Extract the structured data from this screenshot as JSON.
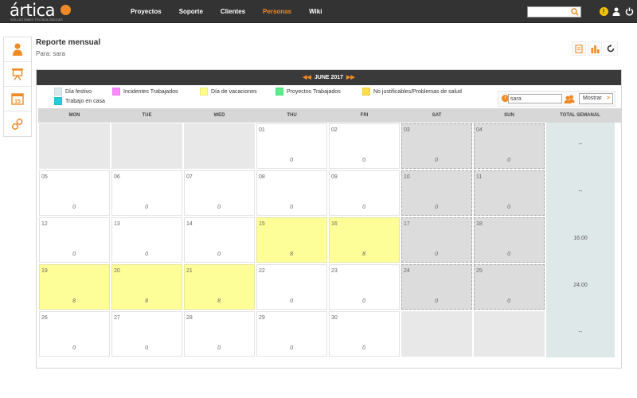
{
  "app": {
    "logo_text": "ártica",
    "logo_subtitle": "SOLUCIONES TECNOLÓGICAS"
  },
  "nav": [
    {
      "label": "Proyectos",
      "active": false
    },
    {
      "label": "Soporte",
      "active": false
    },
    {
      "label": "Clientes",
      "active": false
    },
    {
      "label": "Personas",
      "active": true
    },
    {
      "label": "Wiki",
      "active": false
    }
  ],
  "search": {
    "value": "",
    "placeholder": ""
  },
  "header": {
    "title": "Reporte mensual",
    "subtitle": "Para: sara"
  },
  "calendar": {
    "month_label": "JUNE 2017",
    "legend": [
      {
        "label": "Día festivo",
        "color": "#dbe8ec"
      },
      {
        "label": "Incidentes Trabajados",
        "color": "#ff88ff"
      },
      {
        "label": "Día de vacaciones",
        "color": "#ffff88"
      },
      {
        "label": "Proyectos Trabajados",
        "color": "#55ee88"
      },
      {
        "label": "No justificables/Problemas de salud",
        "color": "#ffdd44"
      },
      {
        "label": "Trabajo en casa",
        "color": "#22ccdd"
      }
    ],
    "filter": {
      "user_value": "sara",
      "button_label": "Mostrar",
      "button_chevron": ">"
    },
    "headers": [
      "MON",
      "TUE",
      "WED",
      "THU",
      "FRI",
      "SAT",
      "SUN",
      "TOTAL SEMANAL"
    ],
    "weeks": [
      {
        "days": [
          {
            "type": "empty"
          },
          {
            "type": "empty"
          },
          {
            "type": "empty"
          },
          {
            "type": "work",
            "day": "01",
            "hours": "0"
          },
          {
            "type": "work",
            "day": "02",
            "hours": "0"
          },
          {
            "type": "weekend",
            "day": "03",
            "hours": "0"
          },
          {
            "type": "weekend",
            "day": "04",
            "hours": "0"
          }
        ],
        "total": "--"
      },
      {
        "days": [
          {
            "type": "work",
            "day": "05",
            "hours": "0"
          },
          {
            "type": "work",
            "day": "06",
            "hours": "0"
          },
          {
            "type": "work",
            "day": "07",
            "hours": "0"
          },
          {
            "type": "work",
            "day": "08",
            "hours": "0"
          },
          {
            "type": "work",
            "day": "09",
            "hours": "0"
          },
          {
            "type": "weekend",
            "day": "10",
            "hours": "0"
          },
          {
            "type": "weekend",
            "day": "11",
            "hours": "0"
          }
        ],
        "total": "--"
      },
      {
        "days": [
          {
            "type": "work",
            "day": "12",
            "hours": "0"
          },
          {
            "type": "work",
            "day": "13",
            "hours": "0"
          },
          {
            "type": "work",
            "day": "14",
            "hours": "0"
          },
          {
            "type": "vac",
            "day": "15",
            "hours": "8"
          },
          {
            "type": "vac",
            "day": "16",
            "hours": "8"
          },
          {
            "type": "weekend",
            "day": "17",
            "hours": "0"
          },
          {
            "type": "weekend",
            "day": "18",
            "hours": "0"
          }
        ],
        "total": "16.00"
      },
      {
        "days": [
          {
            "type": "vac",
            "day": "19",
            "hours": "8"
          },
          {
            "type": "vac",
            "day": "20",
            "hours": "8"
          },
          {
            "type": "vac",
            "day": "21",
            "hours": "8"
          },
          {
            "type": "work",
            "day": "22",
            "hours": "0"
          },
          {
            "type": "work",
            "day": "23",
            "hours": "0"
          },
          {
            "type": "weekend",
            "day": "24",
            "hours": "0"
          },
          {
            "type": "weekend",
            "day": "25",
            "hours": "0"
          }
        ],
        "total": "24.00"
      },
      {
        "days": [
          {
            "type": "work",
            "day": "26",
            "hours": "0"
          },
          {
            "type": "work",
            "day": "27",
            "hours": "0"
          },
          {
            "type": "work",
            "day": "28",
            "hours": "0"
          },
          {
            "type": "work",
            "day": "29",
            "hours": "0"
          },
          {
            "type": "work",
            "day": "30",
            "hours": "0"
          },
          {
            "type": "empty"
          },
          {
            "type": "empty"
          }
        ],
        "total": "--"
      }
    ]
  },
  "colors": {
    "accent": "#f08a24",
    "topbar": "#333333",
    "vacation": "#fefe99",
    "weekend": "#dcdcdc",
    "total_column": "#dfe8e9"
  }
}
